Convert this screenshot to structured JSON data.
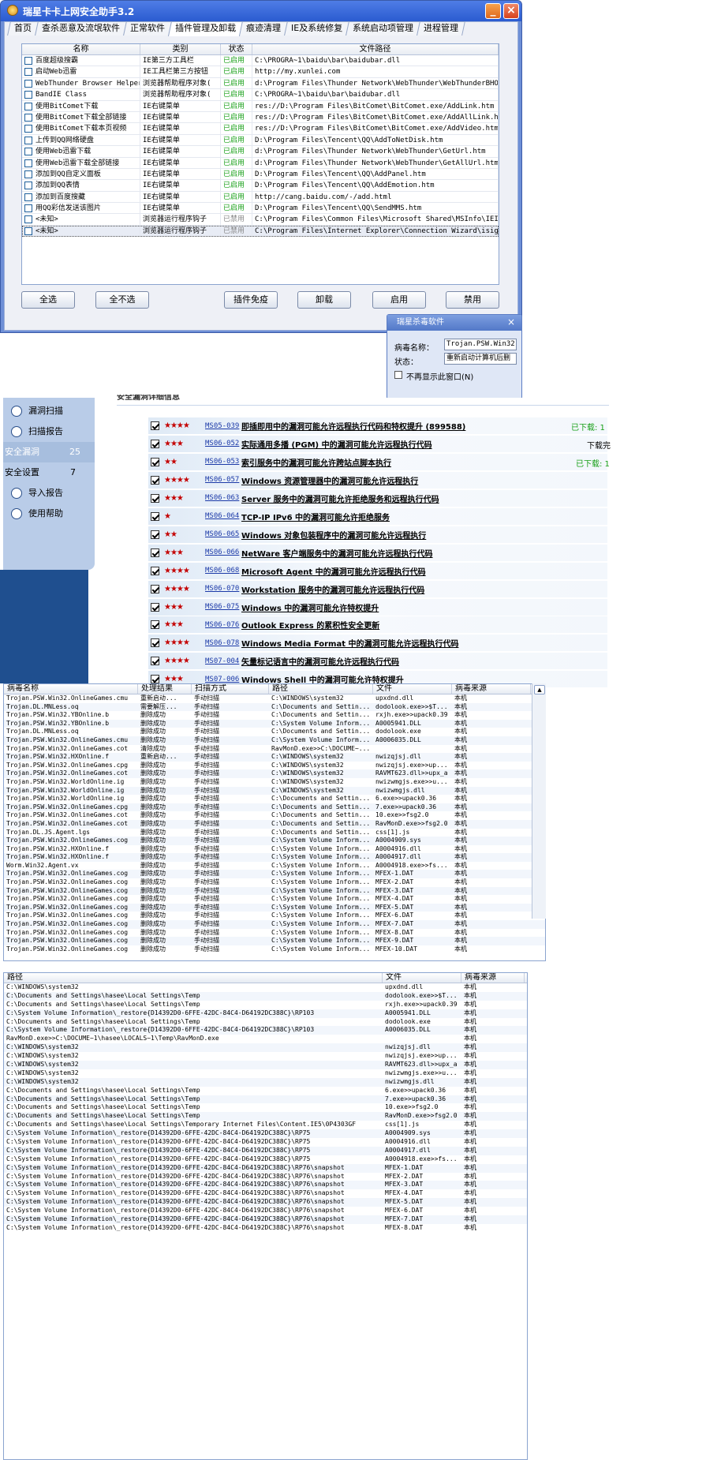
{
  "win1": {
    "title": "瑞星卡卡上网安全助手3.2",
    "min_label": "_",
    "close_label": "×",
    "tabs": [
      "首页",
      "查杀恶意及流氓软件",
      "正常软件",
      "插件管理及卸载",
      "痕迹清理",
      "IE及系统修复",
      "系统启动项管理",
      "进程管理"
    ],
    "active_tab": 3,
    "columns": [
      "名称",
      "类别",
      "状态",
      "文件路径"
    ],
    "rows": [
      {
        "name": "百度超级搜霸",
        "type": "IE第三方工具栏",
        "status": "已启用",
        "path": "C:\\PROGRA~1\\baidu\\bar\\baidubar.dll"
      },
      {
        "name": "启动Web迅雷",
        "type": "IE工具栏第三方按钮",
        "status": "已启用",
        "path": "http://my.xunlei.com"
      },
      {
        "name": "WebThunder Browser Helper",
        "type": "浏览器帮助程序对象(",
        "status": "已启用",
        "path": "d:\\Program Files\\Thunder Network\\WebThunder\\WebThunderBHO_No"
      },
      {
        "name": "BandIE Class",
        "type": "浏览器帮助程序对象(",
        "status": "已启用",
        "path": "C:\\PROGRA~1\\baidu\\bar\\baidubar.dll"
      },
      {
        "name": "使用BitComet下载",
        "type": "IE右键菜单",
        "status": "已启用",
        "path": "res://D:\\Program Files\\BitComet\\BitComet.exe/AddLink.htm"
      },
      {
        "name": "使用BitComet下载全部链接",
        "type": "IE右键菜单",
        "status": "已启用",
        "path": "res://D:\\Program Files\\BitComet\\BitComet.exe/AddAllLink.htm"
      },
      {
        "name": "使用BitComet下载本页视频",
        "type": "IE右键菜单",
        "status": "已启用",
        "path": "res://D:\\Program Files\\BitComet\\BitComet.exe/AddVideo.htm"
      },
      {
        "name": "上传到QQ网络硬盘",
        "type": "IE右键菜单",
        "status": "已启用",
        "path": "D:\\Program Files\\Tencent\\QQ\\AddToNetDisk.htm"
      },
      {
        "name": "使用Web迅雷下载",
        "type": "IE右键菜单",
        "status": "已启用",
        "path": "d:\\Program Files\\Thunder Network\\WebThunder\\GetUrl.htm"
      },
      {
        "name": "使用Web迅雷下载全部链接",
        "type": "IE右键菜单",
        "status": "已启用",
        "path": "d:\\Program Files\\Thunder Network\\WebThunder\\GetAllUrl.htm"
      },
      {
        "name": "添加到QQ自定义面板",
        "type": "IE右键菜单",
        "status": "已启用",
        "path": "D:\\Program Files\\Tencent\\QQ\\AddPanel.htm"
      },
      {
        "name": "添加到QQ表情",
        "type": "IE右键菜单",
        "status": "已启用",
        "path": "D:\\Program Files\\Tencent\\QQ\\AddEmotion.htm"
      },
      {
        "name": "添加到百度搜藏",
        "type": "IE右键菜单",
        "status": "已启用",
        "path": "http://cang.baidu.com/-/add.html"
      },
      {
        "name": "用QQ彩信发送该图片",
        "type": "IE右键菜单",
        "status": "已启用",
        "path": "D:\\Program Files\\Tencent\\QQ\\SendMMS.htm"
      },
      {
        "name": "<未知>",
        "type": "浏览器运行程序钩子",
        "status": "已禁用",
        "path": "C:\\Program Files\\Common Files\\Microsoft Shared\\MSInfo\\IEINFO"
      },
      {
        "name": "<未知>",
        "type": "浏览器运行程序钩子",
        "status": "已禁用",
        "path": "C:\\Program Files\\Internet Explorer\\Connection Wizard\\isignup"
      }
    ],
    "buttons": [
      "全选",
      "全不选",
      "插件免疫",
      "卸载",
      "启用",
      "禁用"
    ]
  },
  "popup": {
    "title": "瑞星杀毒软件",
    "close": "×",
    "virus_label": "病毒名称：",
    "virus_value": "Trojan.PSW.Win32.0",
    "status_label": "状态：",
    "status_value": "重新启动计算机后删",
    "checkbox_label": "不再显示此窗口(N)"
  },
  "scan": {
    "header_partial": "安全漏洞详细信息",
    "sidebar": [
      {
        "label": "漏洞扫描",
        "icon": "search-icon"
      },
      {
        "label": "扫描报告",
        "icon": "report-icon"
      }
    ],
    "sec_holes": {
      "label": "安全漏洞",
      "count": "25"
    },
    "sec_settings": {
      "label": "安全设置",
      "count": "7"
    },
    "sidebar2": [
      {
        "label": "导入报告",
        "icon": "import-icon"
      },
      {
        "label": "使用帮助",
        "icon": "help-icon"
      }
    ],
    "vulns": [
      {
        "stars": "★★★★",
        "id": "MS05-039",
        "title": "即插即用中的漏洞可能允许远程执行代码和特权提升 (899588)",
        "dl": "已下载: 1"
      },
      {
        "stars": "★★★",
        "id": "MS06-052",
        "title": "实际通用多播 (PGM) 中的漏洞可能允许远程执行代码",
        "dl": "下载完"
      },
      {
        "stars": "★★",
        "id": "MS06-053",
        "title": "索引服务中的漏洞可能允许跨站点脚本执行",
        "dl": "已下载: 1"
      },
      {
        "stars": "★★★★",
        "id": "MS06-057",
        "title": "Windows 资源管理器中的漏洞可能允许远程执行",
        "dl": ""
      },
      {
        "stars": "★★★",
        "id": "MS06-063",
        "title": "Server 服务中的漏洞可能允许拒绝服务和远程执行代码",
        "dl": ""
      },
      {
        "stars": "★",
        "id": "MS06-064",
        "title": "TCP-IP IPv6 中的漏洞可能允许拒绝服务",
        "dl": ""
      },
      {
        "stars": "★★",
        "id": "MS06-065",
        "title": "Windows 对象包装程序中的漏洞可能允许远程执行",
        "dl": ""
      },
      {
        "stars": "★★★",
        "id": "MS06-066",
        "title": "NetWare 客户端服务中的漏洞可能允许远程执行代码",
        "dl": ""
      },
      {
        "stars": "★★★★",
        "id": "MS06-068",
        "title": "Microsoft Agent 中的漏洞可能允许远程执行代码",
        "dl": ""
      },
      {
        "stars": "★★★★",
        "id": "MS06-070",
        "title": "Workstation 服务中的漏洞可能允许远程执行代码",
        "dl": ""
      },
      {
        "stars": "★★★",
        "id": "MS06-075",
        "title": "Windows 中的漏洞可能允许特权提升",
        "dl": ""
      },
      {
        "stars": "★★★",
        "id": "MS06-076",
        "title": "Outlook Express 的累积性安全更新",
        "dl": ""
      },
      {
        "stars": "★★★★",
        "id": "MS06-078",
        "title": "Windows Media Format 中的漏洞可能允许远程执行代码",
        "dl": ""
      },
      {
        "stars": "★★★★",
        "id": "MS07-004",
        "title": "矢量标记语言中的漏洞可能允许远程执行代码",
        "dl": ""
      },
      {
        "stars": "★★★",
        "id": "MS07-006",
        "title": "Windows Shell 中的漏洞可能允许特权提升",
        "dl": ""
      }
    ]
  },
  "log": {
    "columns": [
      "病毒名称",
      "处理结果",
      "扫描方式",
      "路径",
      "文件",
      "病毒来源"
    ],
    "scroll_up": "▲",
    "rows": [
      [
        "Trojan.PSW.Win32.OnlineGames.cmu",
        "重新启动...",
        "手动扫描",
        "C:\\WINDOWS\\system32",
        "upxdnd.dll",
        "本机"
      ],
      [
        "Trojan.DL.MNLess.oq",
        "需要解压...",
        "手动扫描",
        "C:\\Documents and Settin...",
        "dodolook.exe>>$T...",
        "本机"
      ],
      [
        "Trojan.PSW.Win32.YBOnline.b",
        "删除成功",
        "手动扫描",
        "C:\\Documents and Settin...",
        "rxjh.exe>>upack0.39",
        "本机"
      ],
      [
        "Trojan.PSW.Win32.YBOnline.b",
        "删除成功",
        "手动扫描",
        "C:\\System Volume Inform...",
        "A0005941.DLL",
        "本机"
      ],
      [
        "Trojan.DL.MNLess.oq",
        "删除成功",
        "手动扫描",
        "C:\\Documents and Settin...",
        "dodolook.exe",
        "本机"
      ],
      [
        "Trojan.PSW.Win32.OnlineGames.cmu",
        "删除成功",
        "手动扫描",
        "C:\\System Volume Inform...",
        "A0006035.DLL",
        "本机"
      ],
      [
        "Trojan.PSW.Win32.OnlineGames.cot",
        "清除成功",
        "手动扫描",
        "RavMonD.exe>>C:\\DOCUME~...",
        "",
        "本机"
      ],
      [
        "Trojan.PSW.Win32.HXOnline.f",
        "重新启动...",
        "手动扫描",
        "C:\\WINDOWS\\system32",
        "nwizqjsj.dll",
        "本机"
      ],
      [
        "Trojan.PSW.Win32.OnlineGames.cpg",
        "删除成功",
        "手动扫描",
        "C:\\WINDOWS\\system32",
        "nwizqjsj.exe>>up...",
        "本机"
      ],
      [
        "Trojan.PSW.Win32.OnlineGames.cot",
        "删除成功",
        "手动扫描",
        "C:\\WINDOWS\\system32",
        "RAVMT623.dll>>upx_a",
        "本机"
      ],
      [
        "Trojan.PSW.Win32.WorldOnline.ig",
        "删除成功",
        "手动扫描",
        "C:\\WINDOWS\\system32",
        "nwizwmgjs.exe>>u...",
        "本机"
      ],
      [
        "Trojan.PSW.Win32.WorldOnline.ig",
        "删除成功",
        "手动扫描",
        "C:\\WINDOWS\\system32",
        "nwizwmgjs.dll",
        "本机"
      ],
      [
        "Trojan.PSW.Win32.WorldOnline.ig",
        "删除成功",
        "手动扫描",
        "C:\\Documents and Settin...",
        "6.exe>>upack0.36",
        "本机"
      ],
      [
        "Trojan.PSW.Win32.OnlineGames.cpg",
        "删除成功",
        "手动扫描",
        "C:\\Documents and Settin...",
        "7.exe>>upack0.36",
        "本机"
      ],
      [
        "Trojan.PSW.Win32.OnlineGames.cot",
        "删除成功",
        "手动扫描",
        "C:\\Documents and Settin...",
        "10.exe>>fsg2.0",
        "本机"
      ],
      [
        "Trojan.PSW.Win32.OnlineGames.cot",
        "删除成功",
        "手动扫描",
        "C:\\Documents and Settin...",
        "RavMonD.exe>>fsg2.0",
        "本机"
      ],
      [
        "Trojan.DL.JS.Agent.lgs",
        "删除成功",
        "手动扫描",
        "C:\\Documents and Settin...",
        "css[1].js",
        "本机"
      ],
      [
        "Trojan.PSW.Win32.OnlineGames.cog",
        "删除成功",
        "手动扫描",
        "C:\\System Volume Inform...",
        "A0004909.sys",
        "本机"
      ],
      [
        "Trojan.PSW.Win32.HXOnline.f",
        "删除成功",
        "手动扫描",
        "C:\\System Volume Inform...",
        "A0004916.dll",
        "本机"
      ],
      [
        "Trojan.PSW.Win32.HXOnline.f",
        "删除成功",
        "手动扫描",
        "C:\\System Volume Inform...",
        "A0004917.dll",
        "本机"
      ],
      [
        "Worm.Win32.Agent.vx",
        "删除成功",
        "手动扫描",
        "C:\\System Volume Inform...",
        "A0004918.exe>>fs...",
        "本机"
      ],
      [
        "Trojan.PSW.Win32.OnlineGames.cog",
        "删除成功",
        "手动扫描",
        "C:\\System Volume Inform...",
        "MFEX-1.DAT",
        "本机"
      ],
      [
        "Trojan.PSW.Win32.OnlineGames.cog",
        "删除成功",
        "手动扫描",
        "C:\\System Volume Inform...",
        "MFEX-2.DAT",
        "本机"
      ],
      [
        "Trojan.PSW.Win32.OnlineGames.cog",
        "删除成功",
        "手动扫描",
        "C:\\System Volume Inform...",
        "MFEX-3.DAT",
        "本机"
      ],
      [
        "Trojan.PSW.Win32.OnlineGames.cog",
        "删除成功",
        "手动扫描",
        "C:\\System Volume Inform...",
        "MFEX-4.DAT",
        "本机"
      ],
      [
        "Trojan.PSW.Win32.OnlineGames.cog",
        "删除成功",
        "手动扫描",
        "C:\\System Volume Inform...",
        "MFEX-5.DAT",
        "本机"
      ],
      [
        "Trojan.PSW.Win32.OnlineGames.cog",
        "删除成功",
        "手动扫描",
        "C:\\System Volume Inform...",
        "MFEX-6.DAT",
        "本机"
      ],
      [
        "Trojan.PSW.Win32.OnlineGames.cog",
        "删除成功",
        "手动扫描",
        "C:\\System Volume Inform...",
        "MFEX-7.DAT",
        "本机"
      ],
      [
        "Trojan.PSW.Win32.OnlineGames.cog",
        "删除成功",
        "手动扫描",
        "C:\\System Volume Inform...",
        "MFEX-8.DAT",
        "本机"
      ],
      [
        "Trojan.PSW.Win32.OnlineGames.cog",
        "删除成功",
        "手动扫描",
        "C:\\System Volume Inform...",
        "MFEX-9.DAT",
        "本机"
      ],
      [
        "Trojan.PSW.Win32.OnlineGames.cog",
        "删除成功",
        "手动扫描",
        "C:\\System Volume Inform...",
        "MFEX-10.DAT",
        "本机"
      ]
    ]
  },
  "paths": {
    "columns": [
      "路径",
      "文件",
      "病毒来源"
    ],
    "rows": [
      [
        "C:\\WINDOWS\\system32",
        "upxdnd.dll",
        "本机"
      ],
      [
        "C:\\Documents and Settings\\hasee\\Local Settings\\Temp",
        "dodolook.exe>>$T...",
        "本机"
      ],
      [
        "C:\\Documents and Settings\\hasee\\Local Settings\\Temp",
        "rxjh.exe>>upack0.39",
        "本机"
      ],
      [
        "C:\\System Volume Information\\_restore{D14392D0-6FFE-42DC-84C4-D64192DC388C}\\RP103",
        "A0005941.DLL",
        "本机"
      ],
      [
        "C:\\Documents and Settings\\hasee\\Local Settings\\Temp",
        "dodolook.exe",
        "本机"
      ],
      [
        "C:\\System Volume Information\\_restore{D14392D0-6FFE-42DC-84C4-D64192DC388C}\\RP103",
        "A0006035.DLL",
        "本机"
      ],
      [
        "RavMonD.exe>>C:\\DOCUME~1\\hasee\\LOCALS~1\\Temp\\RavMonD.exe",
        "",
        "本机"
      ],
      [
        "C:\\WINDOWS\\system32",
        "nwizqjsj.dll",
        "本机"
      ],
      [
        "C:\\WINDOWS\\system32",
        "nwizqjsj.exe>>up...",
        "本机"
      ],
      [
        "C:\\WINDOWS\\system32",
        "RAVMT623.dll>>upx_a",
        "本机"
      ],
      [
        "C:\\WINDOWS\\system32",
        "nwizwmgjs.exe>>u...",
        "本机"
      ],
      [
        "C:\\WINDOWS\\system32",
        "nwizwmgjs.dll",
        "本机"
      ],
      [
        "C:\\Documents and Settings\\hasee\\Local Settings\\Temp",
        "6.exe>>upack0.36",
        "本机"
      ],
      [
        "C:\\Documents and Settings\\hasee\\Local Settings\\Temp",
        "7.exe>>upack0.36",
        "本机"
      ],
      [
        "C:\\Documents and Settings\\hasee\\Local Settings\\Temp",
        "10.exe>>fsg2.0",
        "本机"
      ],
      [
        "C:\\Documents and Settings\\hasee\\Local Settings\\Temp",
        "RavMonD.exe>>fsg2.0",
        "本机"
      ],
      [
        "C:\\Documents and Settings\\hasee\\Local Settings\\Temporary Internet Files\\Content.IE5\\0P4303GF",
        "css[1].js",
        "本机"
      ],
      [
        "C:\\System Volume Information\\_restore{D14392D0-6FFE-42DC-84C4-D64192DC388C}\\RP75",
        "A0004909.sys",
        "本机"
      ],
      [
        "C:\\System Volume Information\\_restore{D14392D0-6FFE-42DC-84C4-D64192DC388C}\\RP75",
        "A0004916.dll",
        "本机"
      ],
      [
        "C:\\System Volume Information\\_restore{D14392D0-6FFE-42DC-84C4-D64192DC388C}\\RP75",
        "A0004917.dll",
        "本机"
      ],
      [
        "C:\\System Volume Information\\_restore{D14392D0-6FFE-42DC-84C4-D64192DC388C}\\RP75",
        "A0004918.exe>>fs...",
        "本机"
      ],
      [
        "C:\\System Volume Information\\_restore{D14392D0-6FFE-42DC-84C4-D64192DC388C}\\RP76\\snapshot",
        "MFEX-1.DAT",
        "本机"
      ],
      [
        "C:\\System Volume Information\\_restore{D14392D0-6FFE-42DC-84C4-D64192DC388C}\\RP76\\snapshot",
        "MFEX-2.DAT",
        "本机"
      ],
      [
        "C:\\System Volume Information\\_restore{D14392D0-6FFE-42DC-84C4-D64192DC388C}\\RP76\\snapshot",
        "MFEX-3.DAT",
        "本机"
      ],
      [
        "C:\\System Volume Information\\_restore{D14392D0-6FFE-42DC-84C4-D64192DC388C}\\RP76\\snapshot",
        "MFEX-4.DAT",
        "本机"
      ],
      [
        "C:\\System Volume Information\\_restore{D14392D0-6FFE-42DC-84C4-D64192DC388C}\\RP76\\snapshot",
        "MFEX-5.DAT",
        "本机"
      ],
      [
        "C:\\System Volume Information\\_restore{D14392D0-6FFE-42DC-84C4-D64192DC388C}\\RP76\\snapshot",
        "MFEX-6.DAT",
        "本机"
      ],
      [
        "C:\\System Volume Information\\_restore{D14392D0-6FFE-42DC-84C4-D64192DC388C}\\RP76\\snapshot",
        "MFEX-7.DAT",
        "本机"
      ],
      [
        "C:\\System Volume Information\\_restore{D14392D0-6FFE-42DC-84C4-D64192DC388C}\\RP76\\snapshot",
        "MFEX-8.DAT",
        "本机"
      ]
    ]
  }
}
